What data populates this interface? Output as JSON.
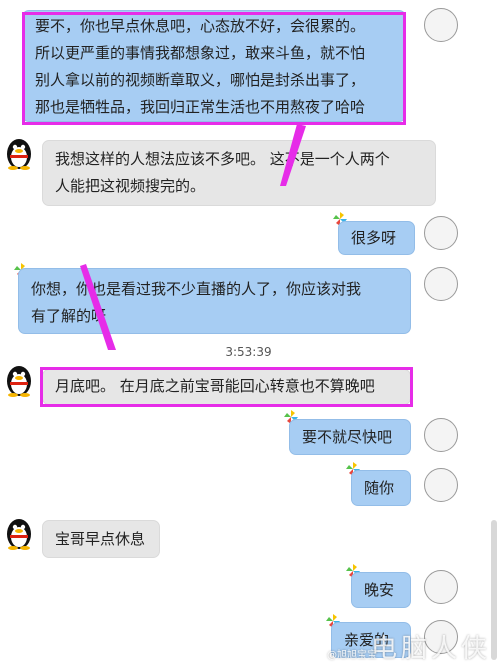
{
  "messages": [
    {
      "lines": [
        "要不，你也早点休息吧，心态放不好，会很累的。",
        "所以更严重的事情我都想象过，敢来斗鱼，就不怕",
        "别人拿以前的视频断章取义，哪怕是封杀出事了，",
        "那也是牺牲品，我回归正常生活也不用熬夜了哈哈"
      ]
    },
    {
      "lines": [
        "我想这样的人想法应该不多吧。 这不是一个人两个",
        "人能把这视频搜完的。"
      ]
    },
    {
      "lines": [
        "很多呀"
      ]
    },
    {
      "lines": [
        "你想，你也是看过我不少直播的人了，你应该对我",
        "有了解的呀"
      ]
    },
    {
      "lines": [
        "月底吧。  在月底之前宝哥能回心转意也不算晚吧"
      ]
    },
    {
      "lines": [
        "要不就尽快吧"
      ]
    },
    {
      "lines": [
        "随你"
      ]
    },
    {
      "lines": [
        "宝哥早点休息"
      ]
    },
    {
      "lines": [
        "晚安"
      ]
    },
    {
      "lines": [
        "亲爱的"
      ]
    }
  ],
  "timestamp": "3:53:39",
  "watermark": {
    "main": "电脑人侠",
    "sub": "@旭旭宝宝"
  },
  "colors": {
    "outgoing": "#a7cdf3",
    "incoming": "#e6e6e6",
    "highlight": "#e62ce8"
  }
}
